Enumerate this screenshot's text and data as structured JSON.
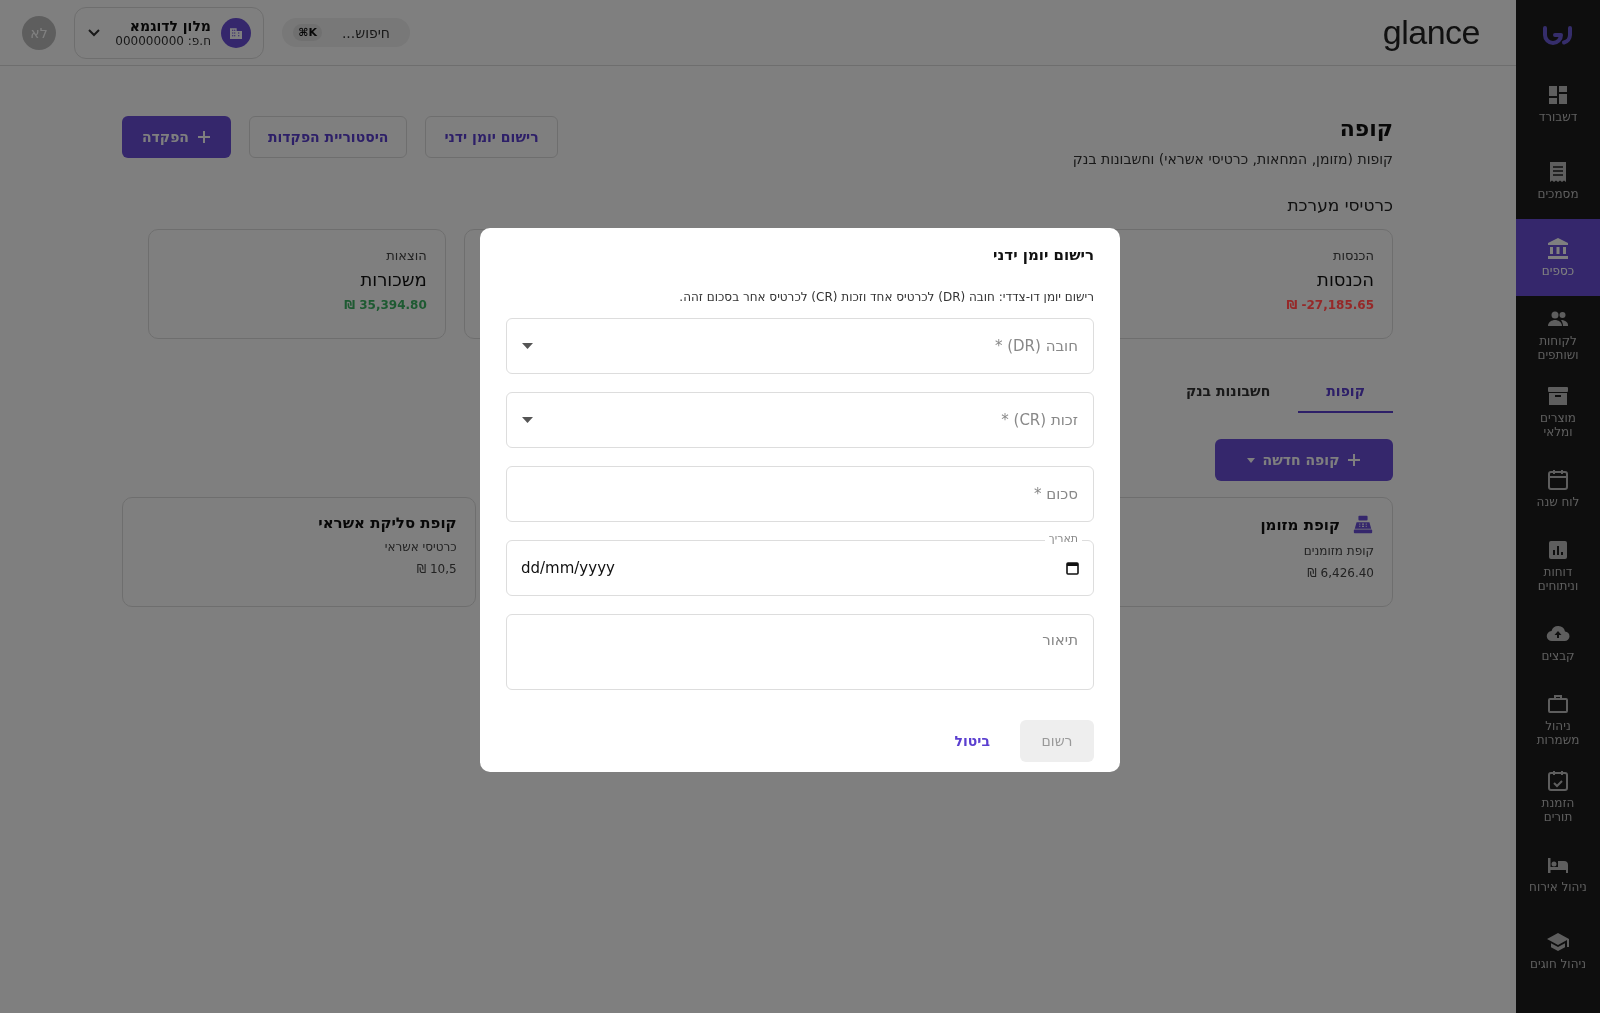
{
  "sidebar": {
    "items": [
      {
        "label": "דשבורד",
        "kind": "dashboard",
        "selected": false
      },
      {
        "label": "מסמכים",
        "kind": "document",
        "selected": false
      },
      {
        "label": "כספים",
        "kind": "bank",
        "selected": true
      },
      {
        "label": "לקוחות ושותפים",
        "kind": "people",
        "selected": false
      },
      {
        "label": "מוצרים ומלאי",
        "kind": "archive",
        "selected": false
      },
      {
        "label": "לוח שנה",
        "kind": "calendar",
        "selected": false
      },
      {
        "label": "דוחות וניתוחים",
        "kind": "chart",
        "selected": false
      },
      {
        "label": "קבצים",
        "kind": "cloud",
        "selected": false
      },
      {
        "label": "ניהול משמרות",
        "kind": "briefcase",
        "selected": false
      },
      {
        "label": "הזמנת תורים",
        "kind": "calendar-check",
        "selected": false
      },
      {
        "label": "ניהול אירוח",
        "kind": "bed",
        "selected": false
      },
      {
        "label": "ניהול חוגים",
        "kind": "school",
        "selected": false
      }
    ]
  },
  "topbar": {
    "logo": "glance",
    "search": {
      "placeholder": "חיפוש...",
      "shortcut": "⌘K"
    },
    "business": {
      "name": "מלון לדוגמא",
      "id": "ח.פ: 000000000"
    },
    "avatar": "לא"
  },
  "page": {
    "title": "קופה",
    "subtitle": "קופות (מזומן, המחאות, כרטיסי אשראי) וחשבונות בנק",
    "actions": [
      {
        "label": "רישום יומן ידני",
        "kind": "outline"
      },
      {
        "label": "היסטוריית הפקדות",
        "kind": "outline"
      },
      {
        "label": "הפקדה",
        "kind": "primary"
      }
    ]
  },
  "system_cards": {
    "heading": "כרטיסי מערכת",
    "cards": [
      {
        "type": "הכנסות",
        "name": "הכנסות",
        "amount": "₪ -27,185.65",
        "color": "#962828"
      },
      {
        "type": "הוצאות",
        "name": "משכורות",
        "amount": "₪ 35,394.80",
        "color": "#1e5a32"
      }
    ]
  },
  "tabs": [
    {
      "label": "קופות",
      "selected": true
    },
    {
      "label": "חשבונות בנק",
      "selected": false
    }
  ],
  "new_register_button": "קופה חדשה",
  "registers": [
    {
      "kind": "cash",
      "name": "קופת מזומן",
      "subtitle": "קופת מזומנים",
      "amount": "₪ 6,426.40"
    },
    {
      "kind": "plain",
      "name": "קופת סליקת אשראי",
      "subtitle": "כרטיסי אשראי",
      "amount": "₪ 10,5"
    }
  ],
  "modal": {
    "title": "רישום יומן ידני",
    "description": "רישום יומן דו-צדדי: חובה (DR) לכרטיס אחד וזכות (CR) לכרטיס אחר בסכום זהה.",
    "fields": [
      {
        "kind": "select",
        "placeholder": "חובה (DR) *"
      },
      {
        "kind": "select",
        "placeholder": "זכות (CR) *"
      },
      {
        "kind": "input",
        "placeholder": "סכום *"
      },
      {
        "kind": "date",
        "label": "תאריך",
        "value": "dd/mm/yyyy"
      },
      {
        "kind": "textarea",
        "placeholder": "תיאור"
      }
    ],
    "cancel": "ביטול",
    "submit": {
      "label": "רשום",
      "disabled": true
    }
  }
}
